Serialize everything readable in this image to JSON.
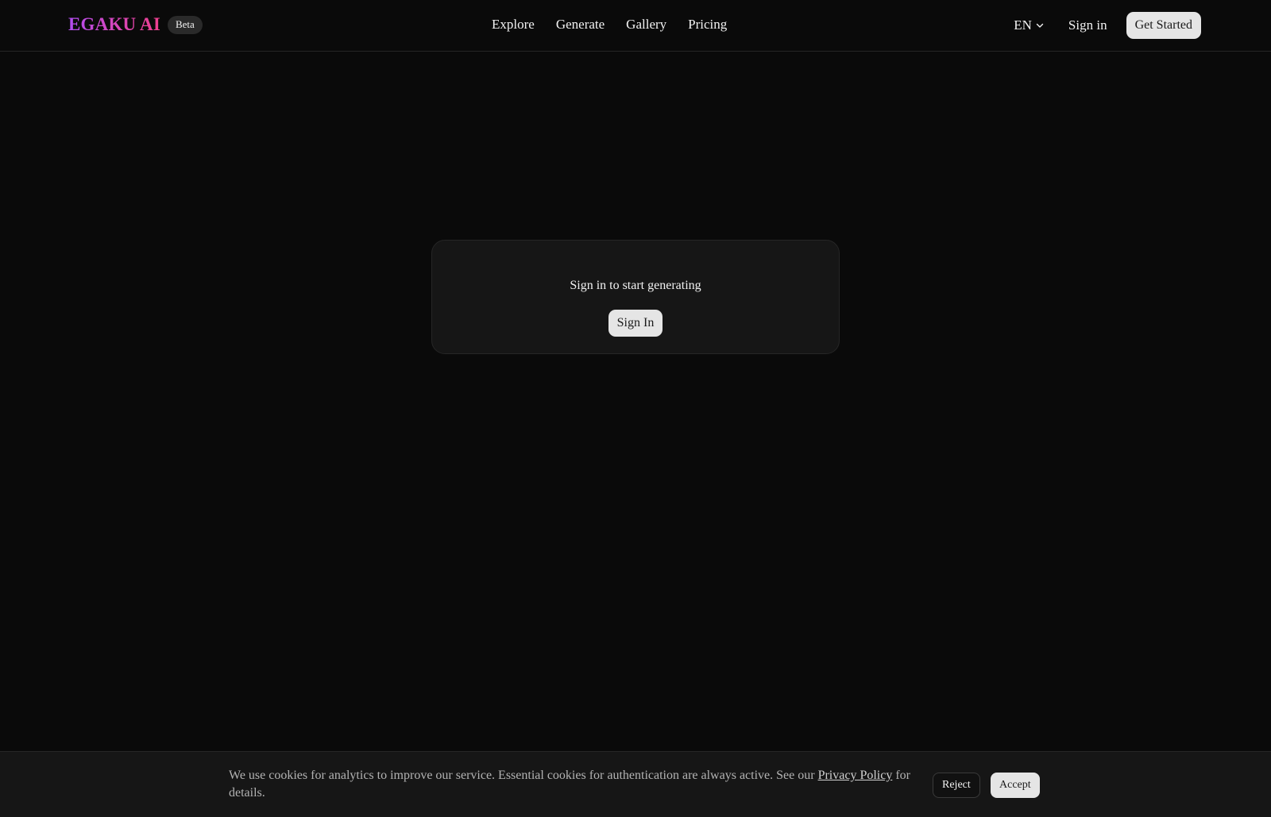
{
  "header": {
    "logo": "EGAKU AI",
    "badge": "Beta",
    "nav": [
      {
        "label": "Explore"
      },
      {
        "label": "Generate"
      },
      {
        "label": "Gallery"
      },
      {
        "label": "Pricing"
      }
    ],
    "language": "EN",
    "language_icon": "chevron-down-icon",
    "sign_in": "Sign in",
    "get_started": "Get Started"
  },
  "main": {
    "prompt": "Sign in to start generating",
    "sign_in_button": "Sign In"
  },
  "cookie": {
    "text": "We use cookies for analytics to improve our service. Essential cookies for authentication are always active. See our ",
    "link": "Privacy Policy",
    "text_after": " for details.",
    "reject": "Reject",
    "accept": "Accept"
  },
  "colors": {
    "background": "#0a0a0a",
    "surface": "#161616",
    "border": "#262626",
    "button": "#e5e5e5",
    "logo_gradient_start": "#b14cf0",
    "logo_gradient_end": "#ee3f8e"
  }
}
